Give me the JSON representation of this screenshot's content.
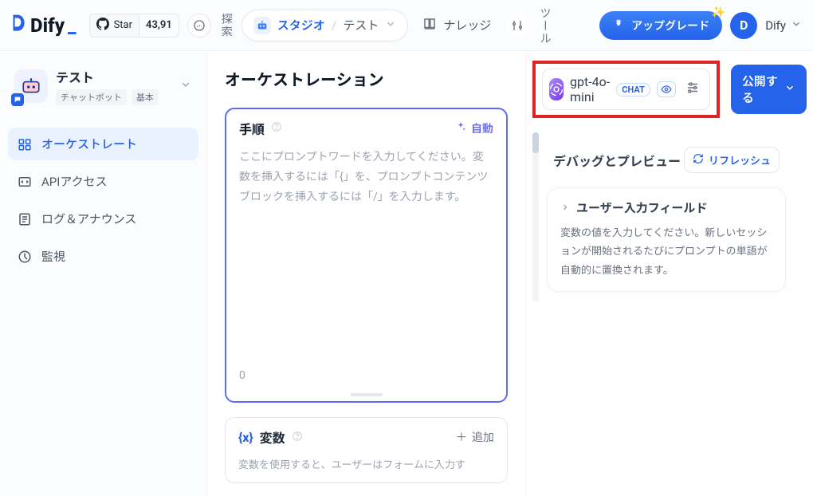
{
  "topbar": {
    "brand": "Dify",
    "github_star_label": "Star",
    "github_star_count": "43,91",
    "explore_label": "探索",
    "studio_label": "スタジオ",
    "current_app": "テスト",
    "knowledge_label": "ナレッジ",
    "tools_label": "ツール",
    "upgrade_label": "アップグレード",
    "avatar_letter": "D",
    "user_name": "Dify"
  },
  "sidebar": {
    "app_name": "テスト",
    "tags": [
      "チャットボット",
      "基本"
    ],
    "items": [
      {
        "label": "オーケストレート",
        "active": true
      },
      {
        "label": "APIアクセス",
        "active": false
      },
      {
        "label": "ログ＆アナウンス",
        "active": false
      },
      {
        "label": "監視",
        "active": false
      }
    ]
  },
  "main": {
    "title": "オーケストレーション",
    "model": {
      "name": "gpt-4o-mini",
      "chat_badge": "CHAT"
    },
    "publish_label": "公開する",
    "prompt": {
      "title": "手順",
      "auto_label": "自動",
      "placeholder": "ここにプロンプトワードを入力してください。変数を挿入するには「{」を、プロンプトコンテンツブロックを挿入するには「/」を入力します。",
      "char_count": "0"
    },
    "variables": {
      "title": "変数",
      "add_label": "追加",
      "desc": "変数を使用すると、ユーザーはフォームに入力す"
    }
  },
  "right": {
    "title": "デバッグとプレビュー",
    "refresh_label": "リフレッシュ",
    "section_title": "ユーザー入力フィールド",
    "section_body": "変数の値を入力してください。新しいセッションが開始されるたびにプロンプトの単語が自動的に置換されます。"
  }
}
